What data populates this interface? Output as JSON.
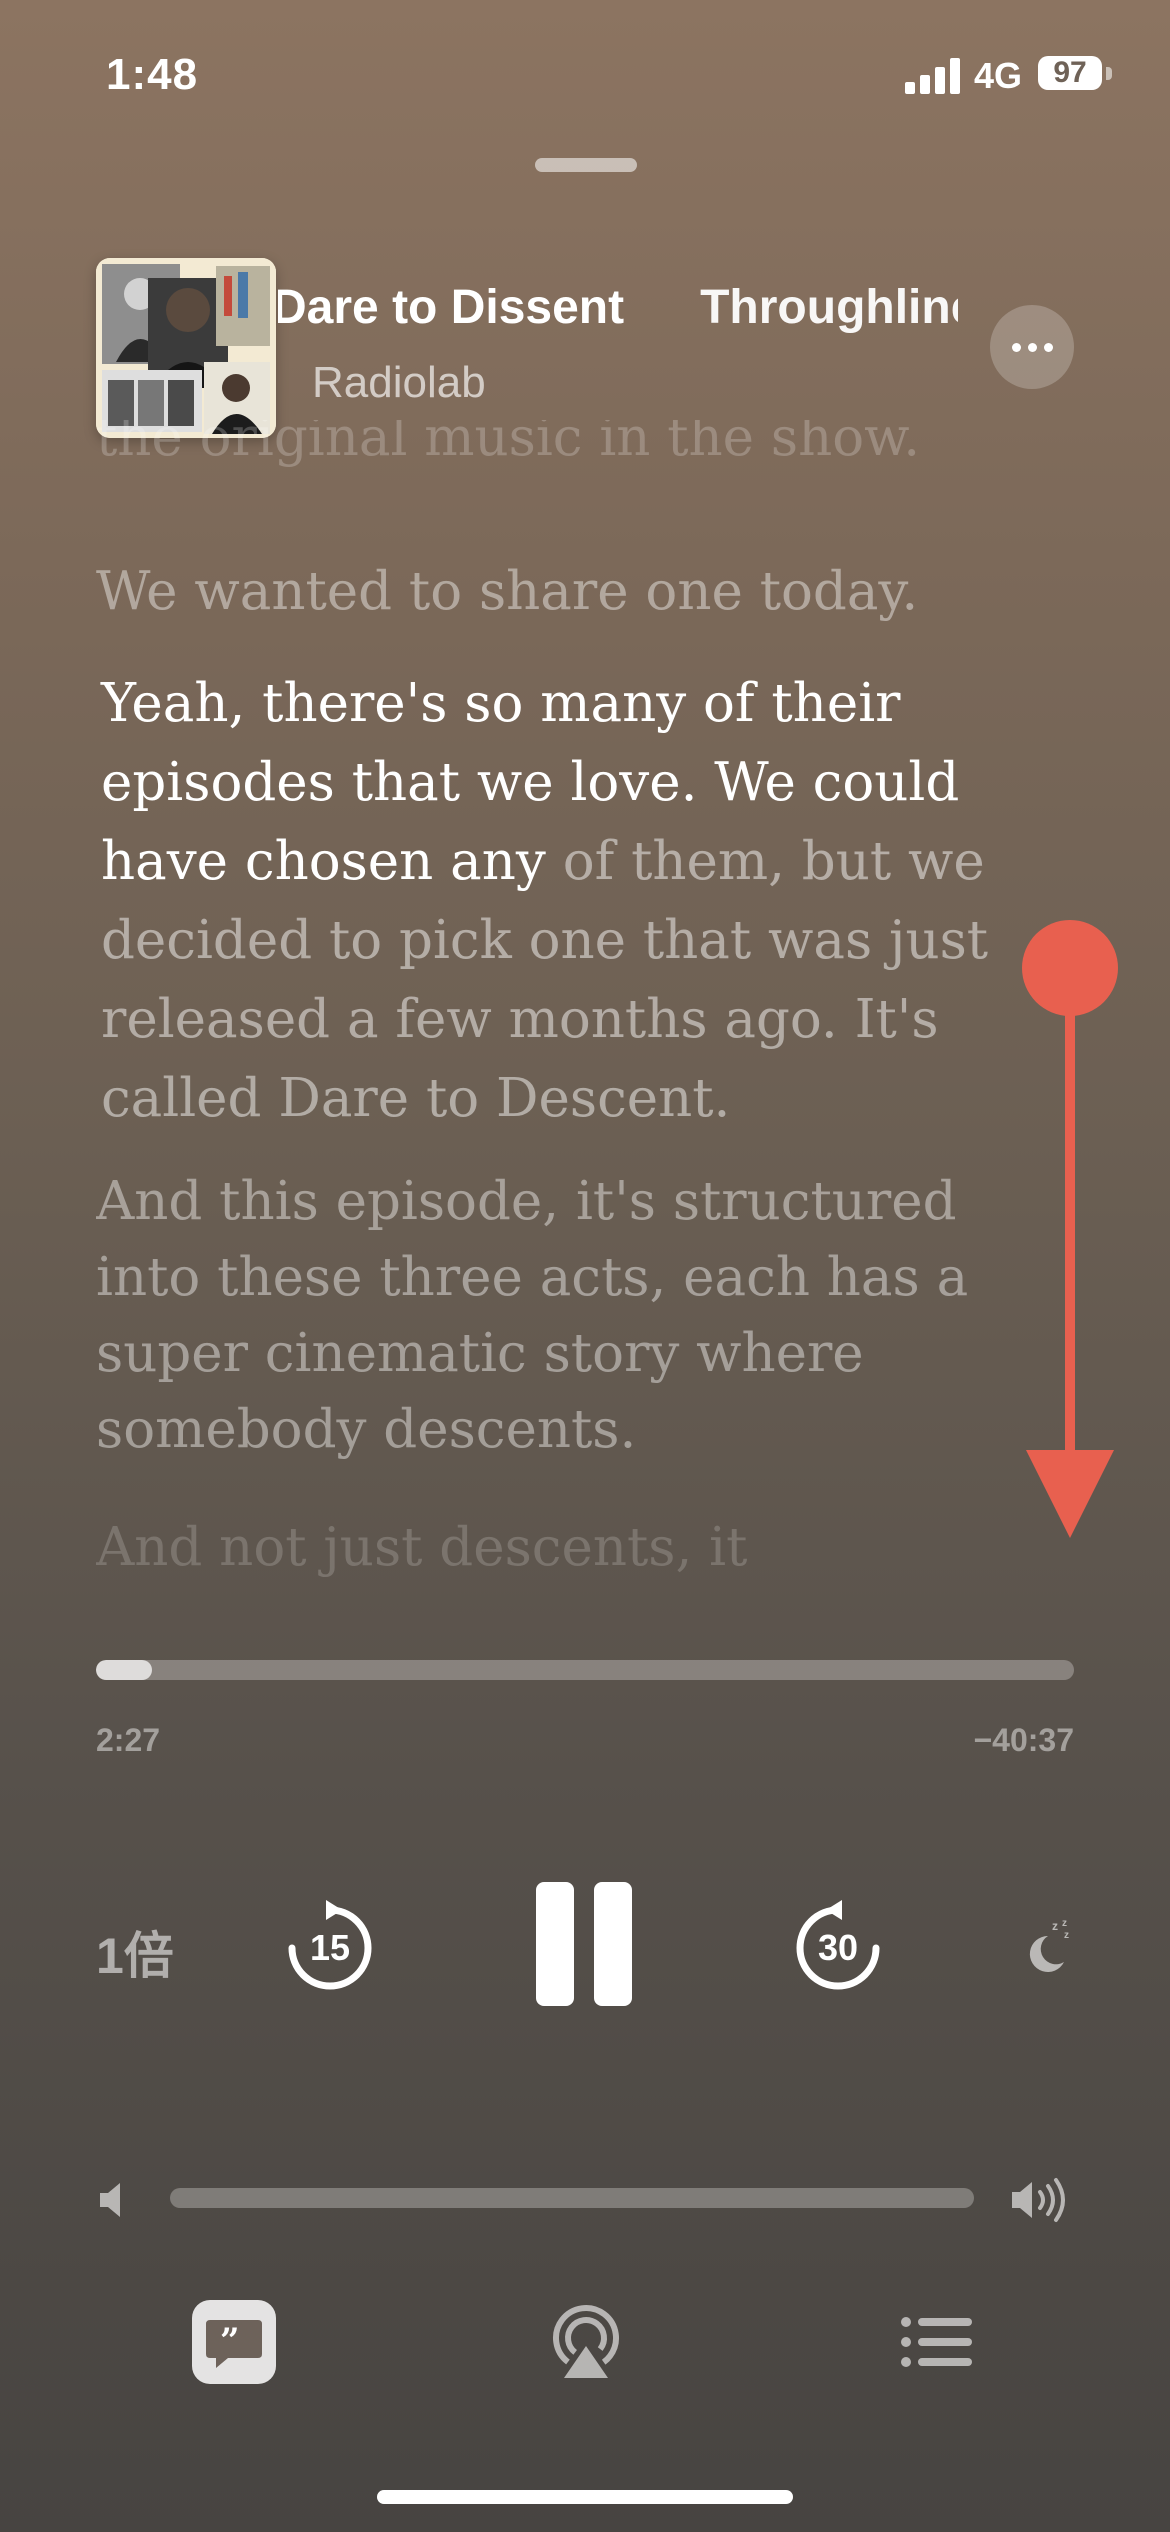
{
  "status_bar": {
    "time": "1:48",
    "network": "4G",
    "battery": "97"
  },
  "now_playing": {
    "episode_title": "Dare to Dissent",
    "next_title": "Throughline",
    "show_name": "Radiolab"
  },
  "transcript": {
    "faded_top": "the original music in the show.",
    "para1": "We wanted to share one today.",
    "para2_spoken": "Yeah, there's so many of their episodes that we love. We could have chosen any",
    "para2_unspoken": " of them, but we decided to pick one that was just released a few months ago. It's called Dare to Descent.",
    "para3": "And this episode, it's structured into these three acts, each has a super cinematic story where somebody descents.",
    "faded_bottom": "And not just descents, it"
  },
  "progress": {
    "elapsed": "2:27",
    "remaining": "−40:37",
    "fraction": 0.057
  },
  "controls": {
    "speed": "1倍",
    "skip_back": "15",
    "skip_forward": "30"
  },
  "volume": {
    "fraction": 0.0
  },
  "annotation": {
    "arrow_color": "#e8604f"
  },
  "colors": {
    "background_top": "#8c7461",
    "background_bottom": "#474441"
  }
}
